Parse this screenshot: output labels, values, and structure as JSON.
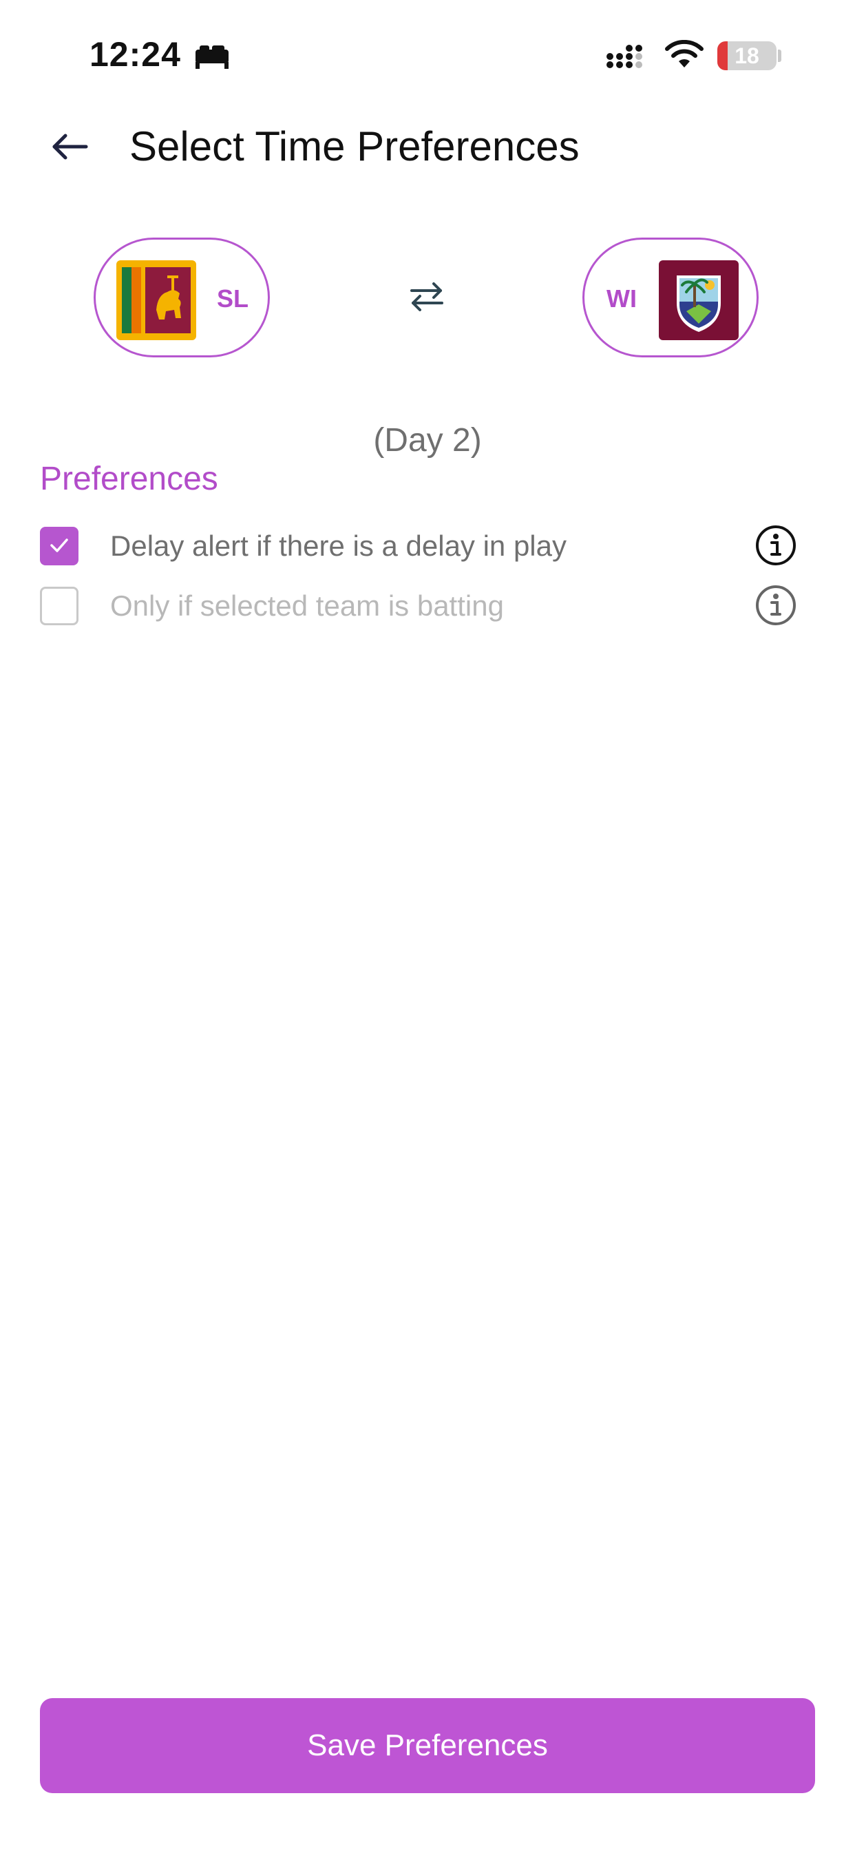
{
  "status_bar": {
    "time": "12:24",
    "battery_level": "18",
    "battery_fraction": 0.18,
    "icons": [
      "sleep-icon",
      "signal-icon",
      "wifi-icon",
      "battery-icon"
    ]
  },
  "header": {
    "title": "Select Time Preferences",
    "back_icon": "arrow-left-icon"
  },
  "match": {
    "team_left": {
      "code": "SL",
      "flag_icon": "sri-lanka-flag-icon"
    },
    "team_right": {
      "code": "WI",
      "flag_icon": "west-indies-crest-icon"
    },
    "swap_icon": "swap-arrows-icon"
  },
  "day_label": "(Day 2)",
  "preferences": {
    "title": "Preferences",
    "items": [
      {
        "label": "Delay alert if there is a delay in play",
        "checked": true,
        "info_icon": "info-icon"
      },
      {
        "label": "Only if selected team is batting",
        "checked": false,
        "info_icon": "info-icon"
      }
    ]
  },
  "save_button": {
    "label": "Save Preferences"
  },
  "colors": {
    "accent": "#b656cf",
    "accent_text": "#b24cc9",
    "button": "#be55d4",
    "muted_text": "#b8b8b8",
    "body_text": "#6f6f6f"
  }
}
